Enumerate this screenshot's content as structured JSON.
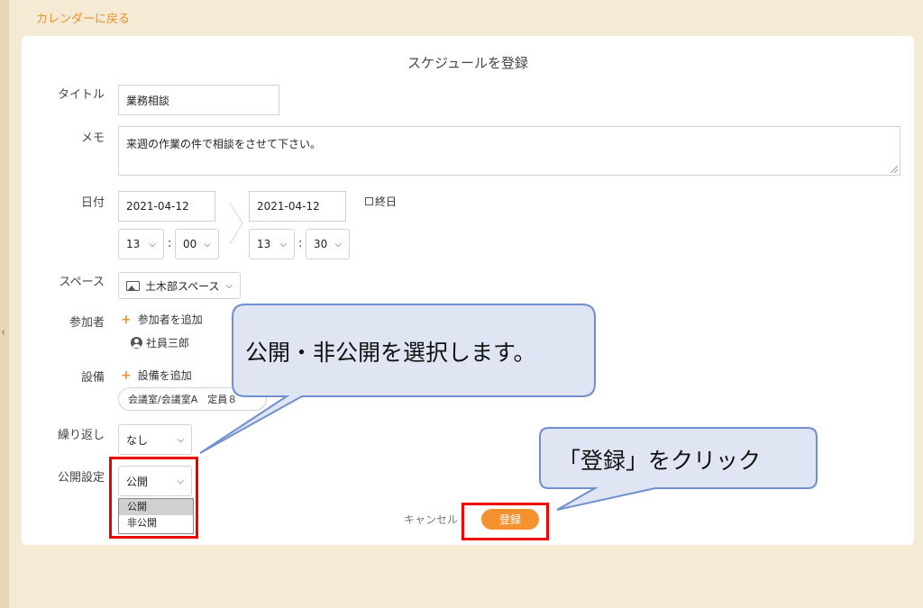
{
  "nav": {
    "back_label": "カレンダーに戻る"
  },
  "form": {
    "title": "スケジュールを登録",
    "title_field": {
      "label": "タイトル",
      "value": "業務相談"
    },
    "memo_field": {
      "label": "メモ",
      "value": "来週の作業の件で相談をさせて下さい。"
    },
    "date_field": {
      "label": "日付",
      "start_date": "2021-04-12",
      "end_date": "2021-04-12",
      "start_hour": "13",
      "start_minute": "00",
      "end_hour": "13",
      "end_minute": "30",
      "time_separator": ":",
      "all_day_label": "終日"
    },
    "space_field": {
      "label": "スペース",
      "value": "土木部スペース"
    },
    "participants_field": {
      "label": "参加者",
      "add_label": "参加者を追加",
      "people": [
        "社員三郎"
      ]
    },
    "equipment_field": {
      "label": "設備",
      "add_label": "設備を追加",
      "chip": "会議室/会議室A　定員８"
    },
    "repeat_field": {
      "label": "繰り返し",
      "value": "なし"
    },
    "visibility_field": {
      "label": "公開設定",
      "value": "公開",
      "options": [
        "公開",
        "非公開"
      ],
      "selected_index": 0
    },
    "cancel_label": "キャンセル",
    "submit_label": "登録"
  },
  "annotations": {
    "callout_visibility": "公開・非公開を選択します。",
    "callout_submit": "「登録」をクリック",
    "highlight_color": "#e00000",
    "callout_fill": "#dfe5f3",
    "callout_border": "#6f8fcf"
  },
  "icons": [
    "chevron-left-icon",
    "chevron-right-icon",
    "chevron-down-icon",
    "image-icon",
    "plus-icon",
    "user-icon",
    "checkbox-icon",
    "resize-handle-icon"
  ],
  "colors": {
    "accent": "#f5922f",
    "background": "#f5ead3",
    "panel": "#ffffff"
  }
}
